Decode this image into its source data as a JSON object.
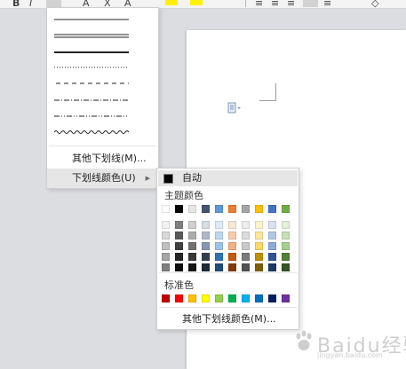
{
  "toolbar": {
    "items": [
      "B",
      "I",
      "A",
      "X",
      "A"
    ]
  },
  "underline_menu": {
    "line_styles": [
      "single",
      "double",
      "thick",
      "dotted",
      "dashed",
      "dash-dot",
      "dash-dot-dot",
      "wave"
    ],
    "more_underlines_label": "其他下划线(M)...",
    "underline_color_label": "下划线颜色(U)"
  },
  "color_menu": {
    "auto_label": "自动",
    "auto_color": "#000000",
    "theme_title": "主题颜色",
    "theme_colors": [
      "#ffffff",
      "#000000",
      "#e7e6e6",
      "#44546a",
      "#5b9bd5",
      "#ed7d31",
      "#a5a5a5",
      "#ffc000",
      "#4472c4",
      "#70ad47"
    ],
    "theme_shades": [
      [
        "#f2f2f2",
        "#7f7f7f",
        "#d0cece",
        "#d6dce4",
        "#deebf6",
        "#fbe5d5",
        "#ededed",
        "#fff2cc",
        "#d9e2f3",
        "#e2efd9"
      ],
      [
        "#d8d8d8",
        "#595959",
        "#aeabab",
        "#adb9ca",
        "#bdd7ee",
        "#f7cbac",
        "#dbdbdb",
        "#fee599",
        "#b4c6e7",
        "#c5e0b3"
      ],
      [
        "#bfbfbf",
        "#3f3f3f",
        "#757070",
        "#8496b0",
        "#9cc3e5",
        "#f4b183",
        "#c9c9c9",
        "#ffd965",
        "#8eaadb",
        "#a8d08d"
      ],
      [
        "#a5a5a5",
        "#262626",
        "#3a3838",
        "#323f4f",
        "#2e75b5",
        "#c55a11",
        "#7b7b7b",
        "#bf9000",
        "#2f5496",
        "#538135"
      ],
      [
        "#7f7f7f",
        "#0c0c0c",
        "#171616",
        "#222a35",
        "#1e4e79",
        "#833c0b",
        "#525252",
        "#7f6000",
        "#1f3864",
        "#375623"
      ]
    ],
    "standard_title": "标准色",
    "standard_colors": [
      "#c00000",
      "#ff0000",
      "#ffc000",
      "#ffff00",
      "#92d050",
      "#00b050",
      "#00b0f0",
      "#0070c0",
      "#002060",
      "#7030a0"
    ],
    "more_colors_label": "其他下划线颜色(M)..."
  },
  "watermark": {
    "text": "Baidu经验",
    "sub": "jingyan.baidu.com"
  }
}
